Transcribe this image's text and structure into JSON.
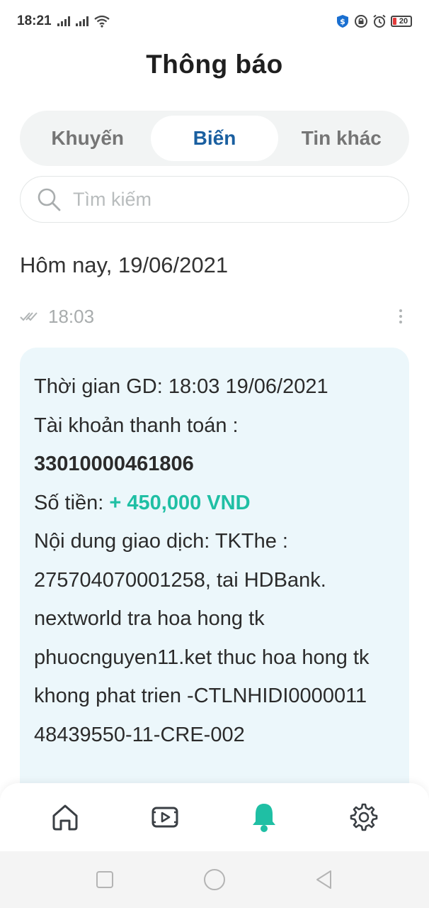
{
  "status_bar": {
    "time": "18:21",
    "battery": "20"
  },
  "page": {
    "title": "Thông báo"
  },
  "tabs": [
    {
      "label": "Khuyến",
      "active": false
    },
    {
      "label": "Biến",
      "active": true
    },
    {
      "label": "Tin khác",
      "active": false
    }
  ],
  "search": {
    "placeholder": "Tìm kiếm",
    "value": ""
  },
  "date_header": "Hôm nay, 19/06/2021",
  "message": {
    "time": "18:03",
    "line_time": "Thời gian GD: 18:03 19/06/2021",
    "line_account_label": "Tài khoản thanh toán :",
    "account_number": "33010000461806",
    "amount_label": "Số tiền: ",
    "amount": "+ 450,000 VND",
    "content_lines": [
      "Nội dung giao dịch: TKThe :",
      "275704070001258, tai HDBank.",
      "nextworld tra hoa hong tk",
      "phuocnguyen11.ket thuc hoa hong tk",
      "khong phat trien -CTLNHIDI0000011",
      "48439550-11-CRE-002"
    ]
  },
  "colors": {
    "accent": "#1fbfa4",
    "active_tab": "#1a5fa0",
    "card_bg": "#ecf7fb",
    "battery_low": "#e23a3a"
  },
  "bottom_nav": [
    {
      "icon": "home-icon",
      "active": false
    },
    {
      "icon": "video-icon",
      "active": false
    },
    {
      "icon": "bell-icon",
      "active": true
    },
    {
      "icon": "gear-icon",
      "active": false
    }
  ],
  "system_nav": [
    "recents-icon",
    "home-circle-icon",
    "back-icon"
  ]
}
